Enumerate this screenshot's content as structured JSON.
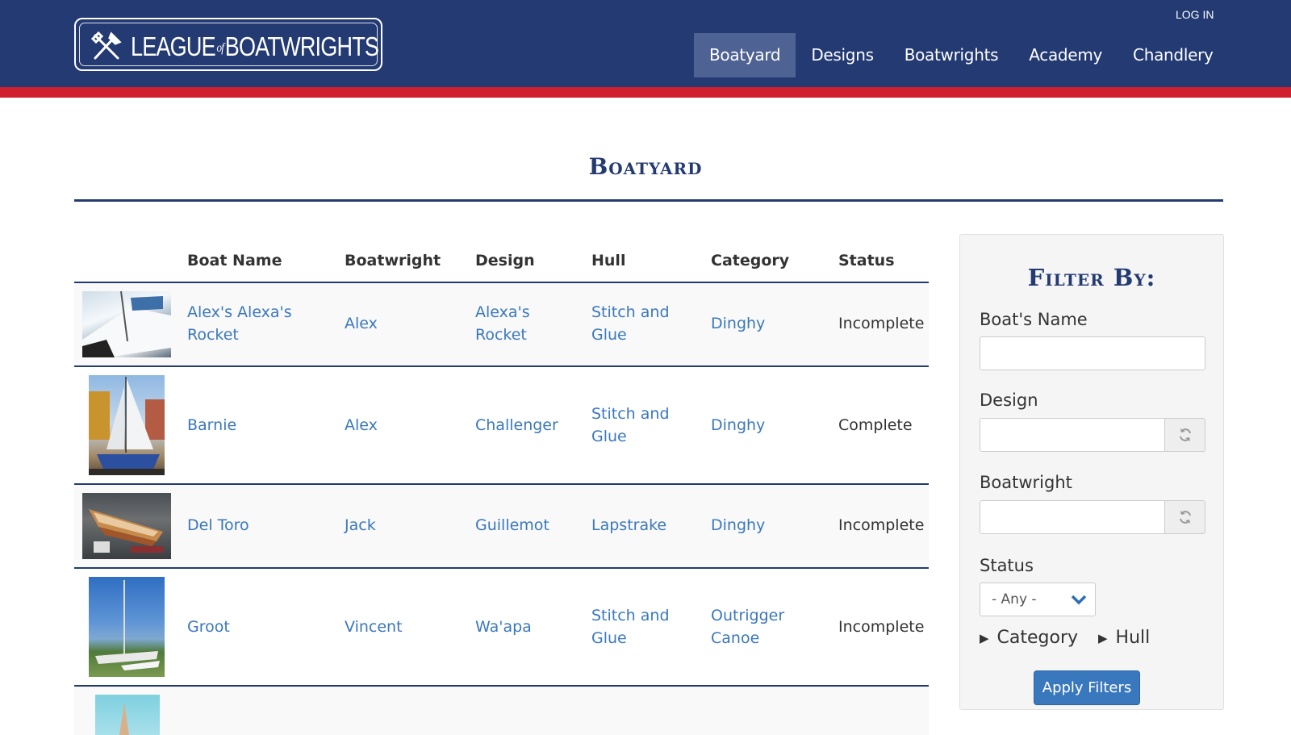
{
  "header": {
    "logo_text_left": "LEAGUE",
    "logo_text_of": "of",
    "logo_text_right": "BOATWRIGHTS",
    "login_label": "LOG IN",
    "nav": [
      {
        "label": "Boatyard",
        "active": true
      },
      {
        "label": "Designs"
      },
      {
        "label": "Boatwrights"
      },
      {
        "label": "Academy"
      },
      {
        "label": "Chandlery"
      }
    ],
    "colors": {
      "primary": "#233a72",
      "accent": "#d01f2e",
      "active_nav": "#4f6294",
      "link": "#3a78bd"
    }
  },
  "page": {
    "title": "Boatyard"
  },
  "table": {
    "headers": [
      "Boat Name",
      "Boatwright",
      "Design",
      "Hull",
      "Category",
      "Status"
    ],
    "rows": [
      {
        "image": "boat-photo-white-hull",
        "name": [
          "Alex's Alexa's",
          "Rocket"
        ],
        "boatwright": "Alex",
        "design": [
          "Alexa's",
          "Rocket"
        ],
        "hull": [
          "Stitch and",
          "Glue"
        ],
        "category": [
          "Dinghy"
        ],
        "status": "Incomplete"
      },
      {
        "image": "boat-photo-white-sail",
        "name": [
          "Barnie"
        ],
        "boatwright": "Alex",
        "design": [
          "Challenger"
        ],
        "hull": [
          "Stitch and",
          "Glue"
        ],
        "category": [
          "Dinghy"
        ],
        "status": "Complete"
      },
      {
        "image": "boat-photo-wooden-dinghy",
        "name": [
          "Del Toro"
        ],
        "boatwright": "Jack",
        "design": [
          "Guillemot"
        ],
        "hull": [
          "Lapstrake"
        ],
        "category": [
          "Dinghy"
        ],
        "status": "Incomplete"
      },
      {
        "image": "boat-photo-outrigger",
        "name": [
          "Groot"
        ],
        "boatwright": "Vincent",
        "design": [
          "Wa'apa"
        ],
        "hull": [
          "Stitch and",
          "Glue"
        ],
        "category": [
          "Outrigger",
          "Canoe"
        ],
        "status": "Incomplete"
      }
    ]
  },
  "filter": {
    "title": "Filter By:",
    "boat_name_label": "Boat's Name",
    "design_label": "Design",
    "boatwright_label": "Boatwright",
    "status_label": "Status",
    "status_selected": "- Any -",
    "category_label": "Category",
    "hull_label": "Hull",
    "apply_label": "Apply Filters"
  }
}
